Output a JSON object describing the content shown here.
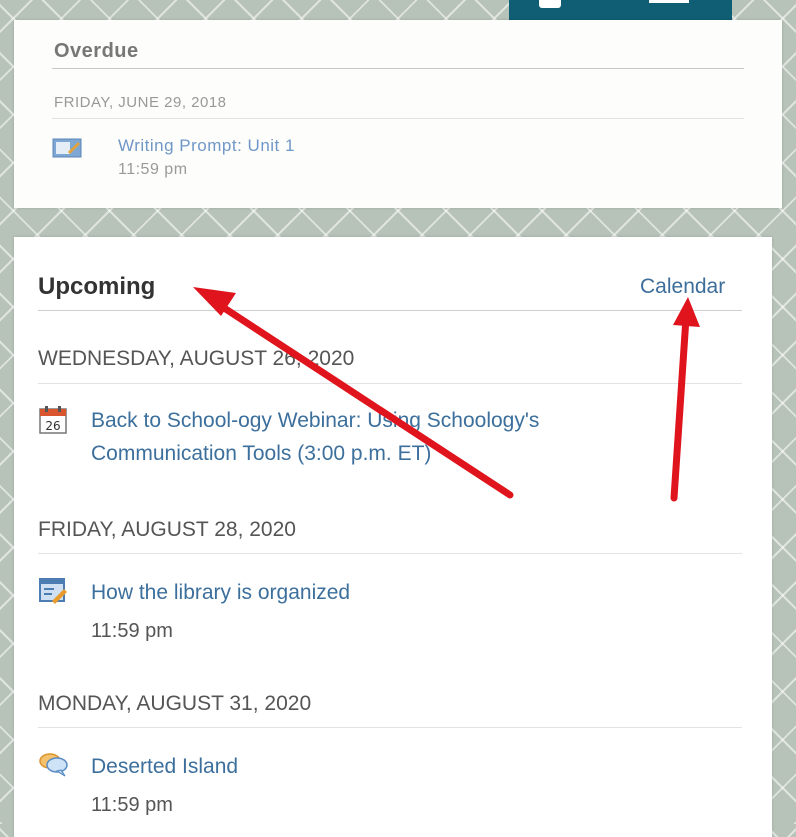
{
  "header_tab": {
    "color": "#0f5e73"
  },
  "overdue": {
    "title": "Overdue",
    "date": "FRIDAY, JUNE 29, 2018",
    "item": {
      "icon": "assignment-icon",
      "title": "Writing Prompt: Unit 1",
      "time": "11:59 pm"
    }
  },
  "upcoming": {
    "title": "Upcoming",
    "calendar_link": "Calendar",
    "groups": [
      {
        "date": "WEDNESDAY, AUGUST 26, 2020",
        "items": [
          {
            "icon": "calendar-event-icon",
            "icon_text": "26",
            "line1": "Back to School-ogy Webinar: Using Schoology's",
            "line2": "Communication Tools (3:00 p.m. ET)"
          }
        ]
      },
      {
        "date": "FRIDAY, AUGUST 28, 2020",
        "items": [
          {
            "icon": "assignment-icon",
            "title": "How the library is organized",
            "time": "11:59 pm"
          }
        ]
      },
      {
        "date": "MONDAY, AUGUST 31, 2020",
        "items": [
          {
            "icon": "discussion-icon",
            "title": "Deserted Island",
            "time": "11:59 pm"
          }
        ]
      }
    ]
  },
  "colors": {
    "link": "#3c6f9c",
    "annotation_arrow": "#e0141c"
  }
}
